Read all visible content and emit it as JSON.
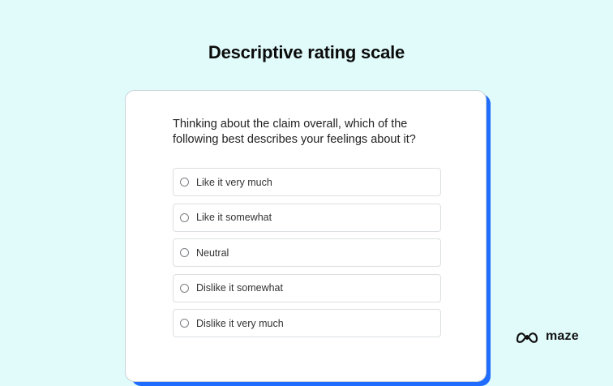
{
  "title": "Descriptive rating scale",
  "question": "Thinking about the claim overall, which of the following best describes your feelings about it?",
  "options": [
    {
      "label": "Like it very much",
      "selected": false
    },
    {
      "label": "Like it somewhat",
      "selected": false
    },
    {
      "label": "Neutral",
      "selected": false
    },
    {
      "label": "Dislike it somewhat",
      "selected": false
    },
    {
      "label": "Dislike it very much",
      "selected": false
    }
  ],
  "logo": {
    "text": "maze",
    "icon": "maze-logo-icon"
  },
  "colors": {
    "background": "#e1fbfb",
    "accent": "#1f6cff",
    "card": "#ffffff"
  }
}
